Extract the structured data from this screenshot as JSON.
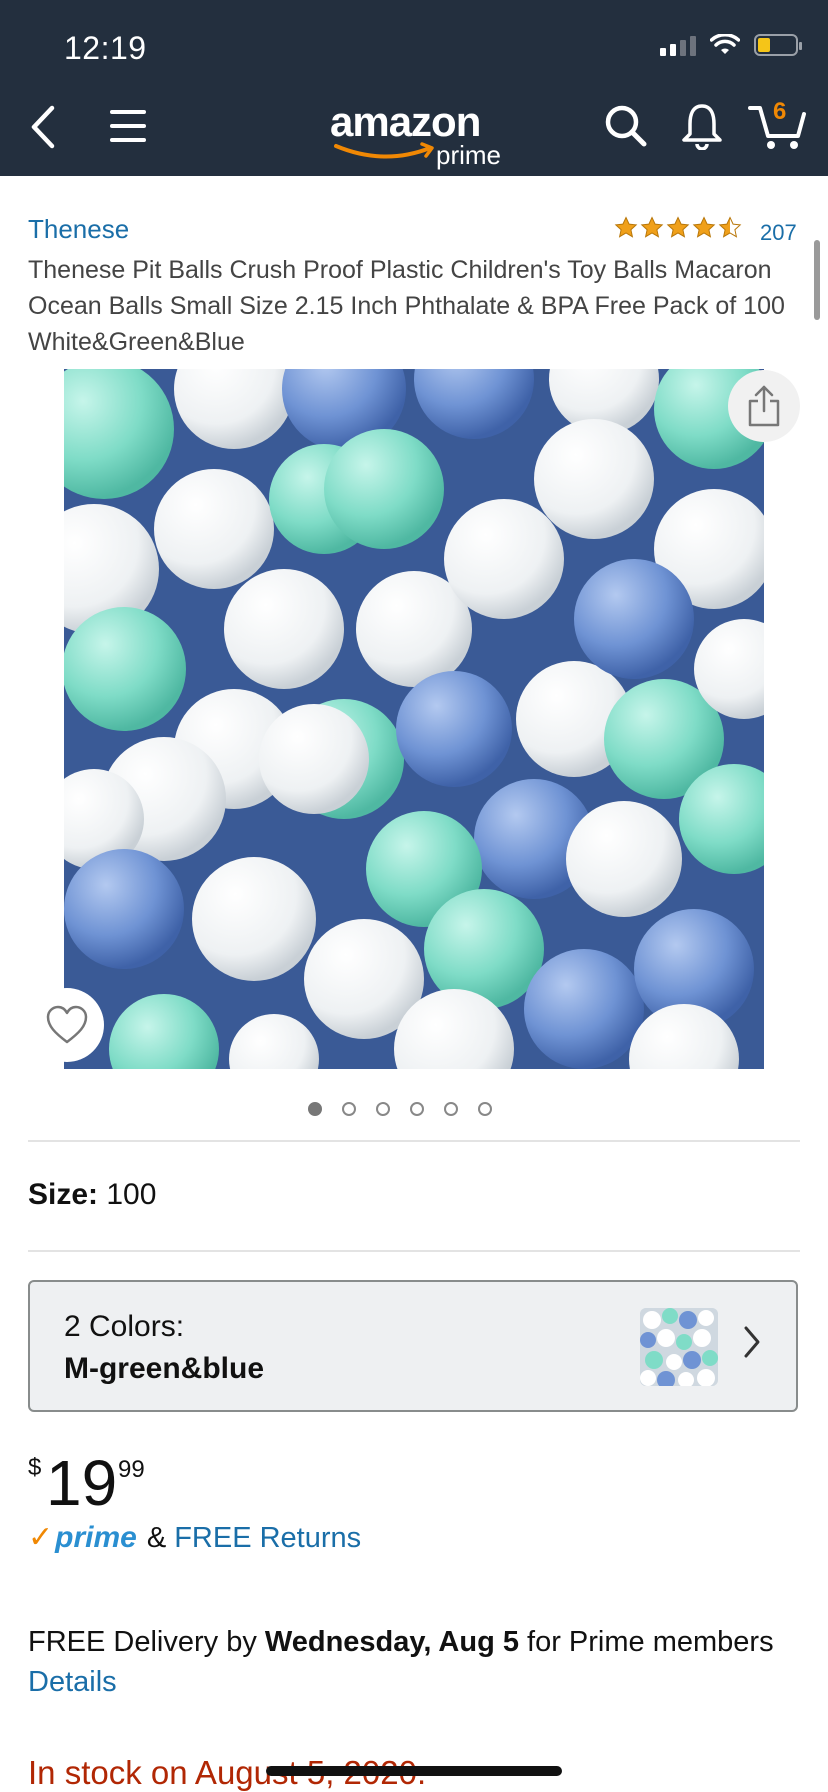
{
  "status_bar": {
    "time": "12:19"
  },
  "nav": {
    "logo_main": "amazon",
    "logo_sub": "prime",
    "cart_count": "6"
  },
  "product": {
    "brand": "Thenese",
    "rating_stars": 4.5,
    "rating_count": "207",
    "title": "Thenese Pit Balls Crush Proof Plastic Children's Toy Balls Macaron Ocean Balls Small Size 2.15 Inch Phthalate & BPA Free Pack of 100 White&Green&Blue",
    "image_count": 6,
    "active_image": 1
  },
  "size": {
    "label": "Size:",
    "value": "100"
  },
  "color": {
    "label": "2 Colors:",
    "value": "M-green&blue"
  },
  "price": {
    "symbol": "$",
    "whole": "19",
    "fraction": "99"
  },
  "prime": {
    "word": "prime",
    "amp": "&",
    "free_returns": "FREE Returns"
  },
  "delivery": {
    "prefix": "FREE Delivery by ",
    "date": "Wednesday, Aug 5",
    "suffix": " for Prime members",
    "details": "Details"
  },
  "stock": {
    "text": "In stock on August 5, 2020."
  },
  "colors": {
    "nav_bg": "#232f3e",
    "link": "#1a6ea8",
    "star": "#f0a01a",
    "prime_blue": "#2a8fd1",
    "prime_check": "#f08804",
    "stock": "#b12704"
  }
}
